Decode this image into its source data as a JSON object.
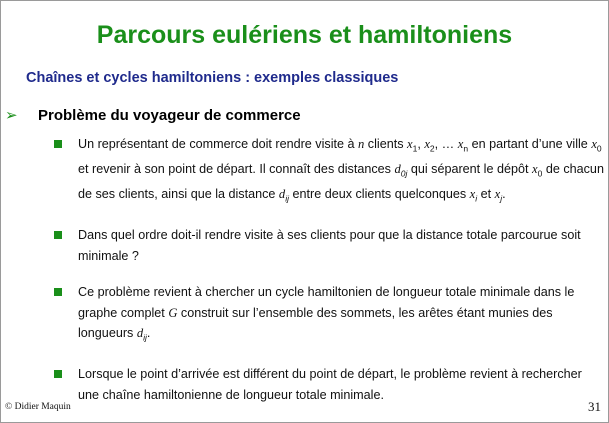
{
  "slide": {
    "title": "Parcours eulériens et hamiltoniens",
    "subtitle": "Chaînes et cycles hamiltoniens : exemples classiques",
    "heading_marker": "➢",
    "heading": "Problème du voyageur de commerce",
    "items": [
      {
        "segments": [
          "Un représentant de commerce doit rendre visite à ",
          "n",
          " clients ",
          "x",
          "1",
          ", ",
          "x",
          "2",
          ", … ",
          "x",
          "n",
          " en partant d’une ville ",
          "x",
          "0",
          " et revenir à son point de départ. Il connaît des distances ",
          "d",
          "0j",
          " qui séparent le dépôt ",
          "x",
          "0",
          " de chacun de ses clients, ainsi que la distance  ",
          "d",
          "ij",
          " entre deux clients quelconques ",
          "x",
          "i",
          " et  ",
          "x",
          "j",
          "."
        ]
      },
      {
        "segments": [
          "Dans quel ordre doit-il rendre visite à ses clients pour que la distance totale parcourue soit minimale ?"
        ]
      },
      {
        "segments": [
          "Ce problème revient à chercher un cycle hamiltonien de longueur totale minimale dans le graphe complet ",
          "G",
          " construit sur l’ensemble des sommets, les arêtes étant munies des longueurs  ",
          "d",
          "ij",
          "."
        ]
      },
      {
        "segments": [
          "Lorsque le point d’arrivée est différent du point de départ, le problème revient à rechercher une chaîne hamiltonienne de longueur totale minimale."
        ]
      }
    ],
    "footer_left": "© Didier Maquin",
    "page_number": "31",
    "colors": {
      "title": "#1a8f1a",
      "subtitle": "#1f2a8c",
      "bullet": "#1a8f1a"
    }
  }
}
